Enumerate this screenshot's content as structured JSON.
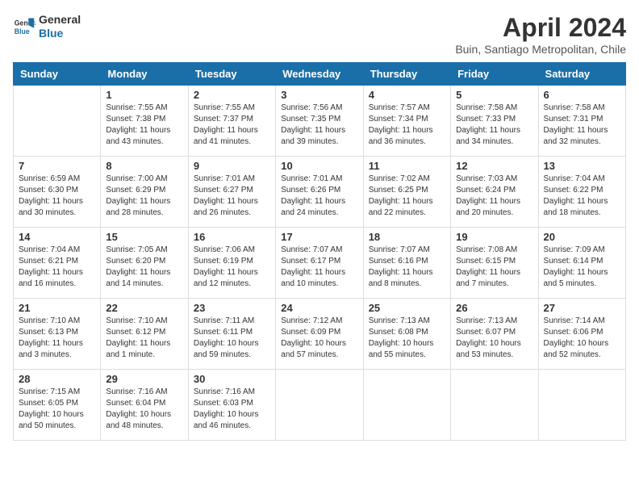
{
  "header": {
    "logo_line1": "General",
    "logo_line2": "Blue",
    "month_year": "April 2024",
    "location": "Buin, Santiago Metropolitan, Chile"
  },
  "weekdays": [
    "Sunday",
    "Monday",
    "Tuesday",
    "Wednesday",
    "Thursday",
    "Friday",
    "Saturday"
  ],
  "weeks": [
    [
      {
        "day": "",
        "info": ""
      },
      {
        "day": "1",
        "info": "Sunrise: 7:55 AM\nSunset: 7:38 PM\nDaylight: 11 hours\nand 43 minutes."
      },
      {
        "day": "2",
        "info": "Sunrise: 7:55 AM\nSunset: 7:37 PM\nDaylight: 11 hours\nand 41 minutes."
      },
      {
        "day": "3",
        "info": "Sunrise: 7:56 AM\nSunset: 7:35 PM\nDaylight: 11 hours\nand 39 minutes."
      },
      {
        "day": "4",
        "info": "Sunrise: 7:57 AM\nSunset: 7:34 PM\nDaylight: 11 hours\nand 36 minutes."
      },
      {
        "day": "5",
        "info": "Sunrise: 7:58 AM\nSunset: 7:33 PM\nDaylight: 11 hours\nand 34 minutes."
      },
      {
        "day": "6",
        "info": "Sunrise: 7:58 AM\nSunset: 7:31 PM\nDaylight: 11 hours\nand 32 minutes."
      }
    ],
    [
      {
        "day": "7",
        "info": "Sunrise: 6:59 AM\nSunset: 6:30 PM\nDaylight: 11 hours\nand 30 minutes."
      },
      {
        "day": "8",
        "info": "Sunrise: 7:00 AM\nSunset: 6:29 PM\nDaylight: 11 hours\nand 28 minutes."
      },
      {
        "day": "9",
        "info": "Sunrise: 7:01 AM\nSunset: 6:27 PM\nDaylight: 11 hours\nand 26 minutes."
      },
      {
        "day": "10",
        "info": "Sunrise: 7:01 AM\nSunset: 6:26 PM\nDaylight: 11 hours\nand 24 minutes."
      },
      {
        "day": "11",
        "info": "Sunrise: 7:02 AM\nSunset: 6:25 PM\nDaylight: 11 hours\nand 22 minutes."
      },
      {
        "day": "12",
        "info": "Sunrise: 7:03 AM\nSunset: 6:24 PM\nDaylight: 11 hours\nand 20 minutes."
      },
      {
        "day": "13",
        "info": "Sunrise: 7:04 AM\nSunset: 6:22 PM\nDaylight: 11 hours\nand 18 minutes."
      }
    ],
    [
      {
        "day": "14",
        "info": "Sunrise: 7:04 AM\nSunset: 6:21 PM\nDaylight: 11 hours\nand 16 minutes."
      },
      {
        "day": "15",
        "info": "Sunrise: 7:05 AM\nSunset: 6:20 PM\nDaylight: 11 hours\nand 14 minutes."
      },
      {
        "day": "16",
        "info": "Sunrise: 7:06 AM\nSunset: 6:19 PM\nDaylight: 11 hours\nand 12 minutes."
      },
      {
        "day": "17",
        "info": "Sunrise: 7:07 AM\nSunset: 6:17 PM\nDaylight: 11 hours\nand 10 minutes."
      },
      {
        "day": "18",
        "info": "Sunrise: 7:07 AM\nSunset: 6:16 PM\nDaylight: 11 hours\nand 8 minutes."
      },
      {
        "day": "19",
        "info": "Sunrise: 7:08 AM\nSunset: 6:15 PM\nDaylight: 11 hours\nand 7 minutes."
      },
      {
        "day": "20",
        "info": "Sunrise: 7:09 AM\nSunset: 6:14 PM\nDaylight: 11 hours\nand 5 minutes."
      }
    ],
    [
      {
        "day": "21",
        "info": "Sunrise: 7:10 AM\nSunset: 6:13 PM\nDaylight: 11 hours\nand 3 minutes."
      },
      {
        "day": "22",
        "info": "Sunrise: 7:10 AM\nSunset: 6:12 PM\nDaylight: 11 hours\nand 1 minute."
      },
      {
        "day": "23",
        "info": "Sunrise: 7:11 AM\nSunset: 6:11 PM\nDaylight: 10 hours\nand 59 minutes."
      },
      {
        "day": "24",
        "info": "Sunrise: 7:12 AM\nSunset: 6:09 PM\nDaylight: 10 hours\nand 57 minutes."
      },
      {
        "day": "25",
        "info": "Sunrise: 7:13 AM\nSunset: 6:08 PM\nDaylight: 10 hours\nand 55 minutes."
      },
      {
        "day": "26",
        "info": "Sunrise: 7:13 AM\nSunset: 6:07 PM\nDaylight: 10 hours\nand 53 minutes."
      },
      {
        "day": "27",
        "info": "Sunrise: 7:14 AM\nSunset: 6:06 PM\nDaylight: 10 hours\nand 52 minutes."
      }
    ],
    [
      {
        "day": "28",
        "info": "Sunrise: 7:15 AM\nSunset: 6:05 PM\nDaylight: 10 hours\nand 50 minutes."
      },
      {
        "day": "29",
        "info": "Sunrise: 7:16 AM\nSunset: 6:04 PM\nDaylight: 10 hours\nand 48 minutes."
      },
      {
        "day": "30",
        "info": "Sunrise: 7:16 AM\nSunset: 6:03 PM\nDaylight: 10 hours\nand 46 minutes."
      },
      {
        "day": "",
        "info": ""
      },
      {
        "day": "",
        "info": ""
      },
      {
        "day": "",
        "info": ""
      },
      {
        "day": "",
        "info": ""
      }
    ]
  ]
}
